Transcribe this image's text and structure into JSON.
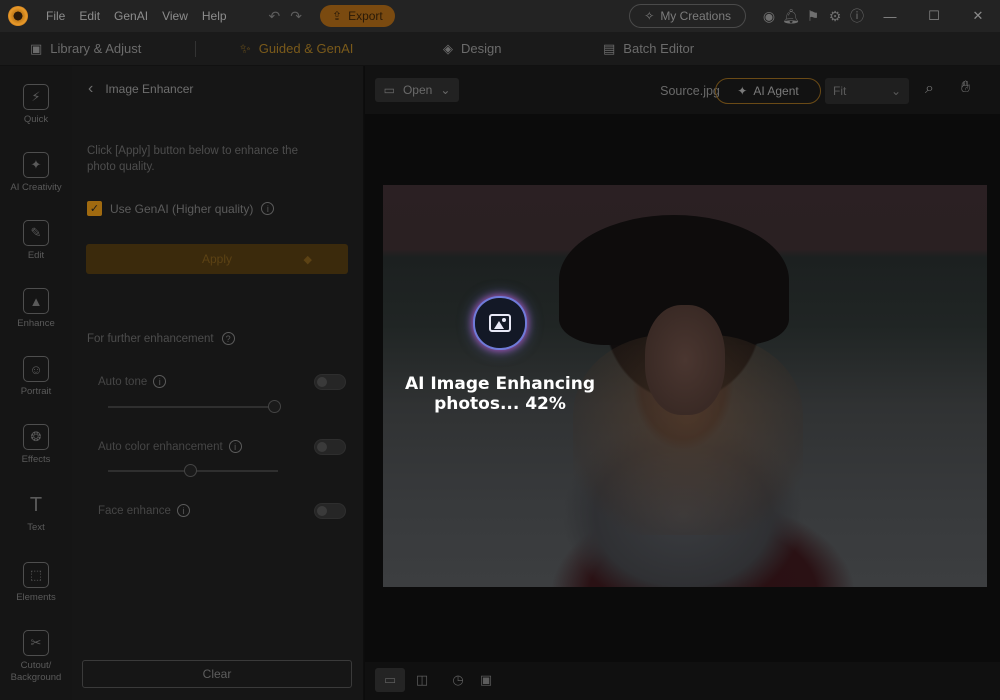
{
  "titlebar": {
    "menu": [
      "File",
      "Edit",
      "GenAI",
      "View",
      "Help"
    ],
    "export_label": "Export",
    "my_creations_label": "My Creations"
  },
  "tabs": [
    {
      "label": "Library & Adjust",
      "icon": "library-icon",
      "active": false
    },
    {
      "label": "Guided & GenAI",
      "icon": "magic-wand-icon",
      "active": true
    },
    {
      "label": "Design",
      "icon": "layers-icon",
      "active": false
    },
    {
      "label": "Batch Editor",
      "icon": "batch-icon",
      "active": false
    }
  ],
  "rail": [
    {
      "label": "Quick",
      "icon": "quick-icon"
    },
    {
      "label": "AI Creativity",
      "icon": "ai-creativity-icon"
    },
    {
      "label": "Edit",
      "icon": "edit-icon"
    },
    {
      "label": "Enhance",
      "icon": "enhance-icon"
    },
    {
      "label": "Portrait",
      "icon": "portrait-icon"
    },
    {
      "label": "Effects",
      "icon": "effects-icon"
    },
    {
      "label": "Text",
      "icon": "text-icon"
    },
    {
      "label": "Elements",
      "icon": "elements-icon"
    },
    {
      "label": "Cutout/ Background",
      "icon": "cutout-icon"
    }
  ],
  "panel": {
    "title": "Image Enhancer",
    "description": "Click [Apply] button below to enhance the photo quality.",
    "genai_label": "Use GenAI (Higher quality)",
    "genai_checked": true,
    "apply_label": "Apply",
    "further_label": "For further enhancement",
    "options": [
      {
        "label": "Auto tone",
        "has_slider": true
      },
      {
        "label": "Auto color enhancement",
        "has_slider": true
      },
      {
        "label": "Face enhance",
        "has_slider": false
      }
    ],
    "clear_label": "Clear"
  },
  "canvas": {
    "open_label": "Open",
    "file_name": "Source.jpg",
    "ai_agent_label": "AI Agent",
    "fit_value": "Fit",
    "progress_text": "AI Image Enhancing photos... 42%",
    "progress_percent": 42
  }
}
